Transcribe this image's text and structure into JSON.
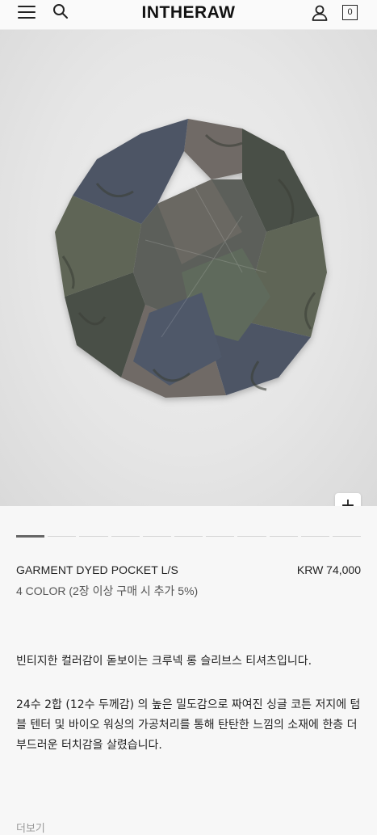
{
  "header": {
    "logo": "INTHERAW",
    "cart_count": "0",
    "icons": [
      "menu-icon",
      "search-icon",
      "user-icon",
      "cart-icon"
    ]
  },
  "gallery": {
    "slide_count": 11,
    "active_index": 0,
    "zoom_label": "+"
  },
  "product": {
    "name": "GARMENT DYED POCKET L/S",
    "price": "KRW 74,000",
    "colors": "4 COLOR (2장 이상 구매 시 추가 5%)"
  },
  "description": {
    "p1": "빈티지한 컬러감이 돋보이는 크루넥 롱 슬리브스 티셔츠입니다.",
    "p2": "24수 2합 (12수 두께감) 의 높은 밀도감으로 짜여진 싱글 코튼 저지에 텀블 텐터 및 바이오 워싱의 가공처리를 통해 탄탄한 느낌의 소재에 한층 더 부드러운 터치감을 살렸습니다."
  },
  "more_label": "더보기",
  "colors": {
    "shirt_olive": "#5f6556",
    "shirt_navy": "#4d5565",
    "shirt_grey": "#6f6b66",
    "shirt_dark": "#4a4f47"
  }
}
